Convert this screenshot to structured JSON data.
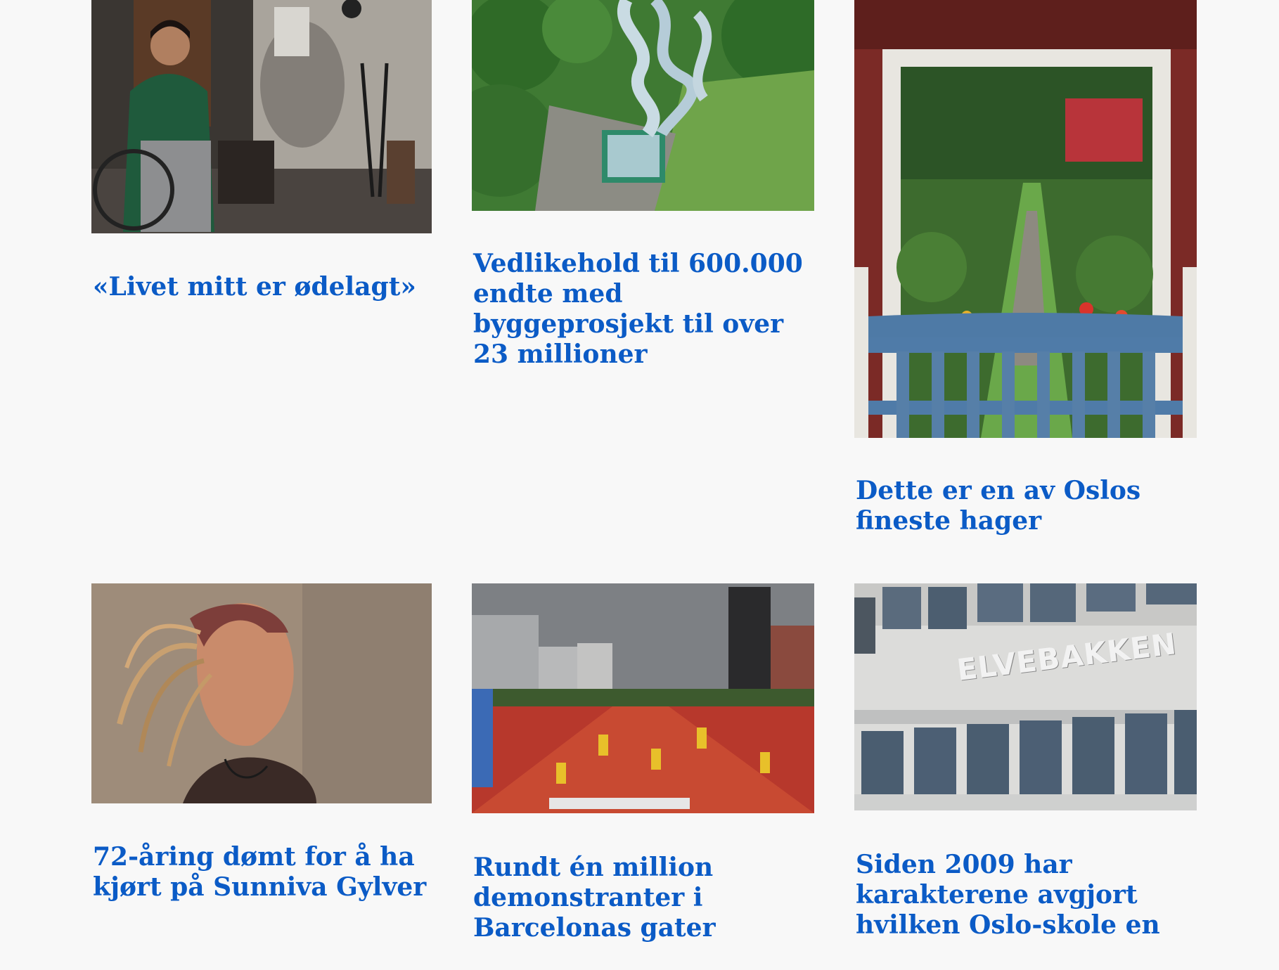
{
  "articles": [
    {
      "headline": "«Livet mitt er ødelagt»",
      "image": "man-in-wheelchair-photo"
    },
    {
      "headline": "Vedlikehold til 600.000 endte med byggeprosjekt til over 23 millioner",
      "image": "water-slide-aerial-photo"
    },
    {
      "headline": "Dette er en av Oslos fineste hager",
      "image": "garden-gate-photo"
    },
    {
      "headline": "72-åring dømt for å ha kjørt på Sunniva Gylver",
      "image": "woman-portrait-photo"
    },
    {
      "headline": "Rundt én million demonstranter i Barcelonas gater",
      "image": "barcelona-crowd-photo"
    },
    {
      "headline": "Siden 2009 har karakterene avgjort hvilken Oslo-skole en",
      "image": "elvebakken-school-photo"
    }
  ],
  "school_sign": "ELVEBAKKEN",
  "colors": {
    "headline": "#0b5bc6",
    "background": "#f8f8f8"
  }
}
